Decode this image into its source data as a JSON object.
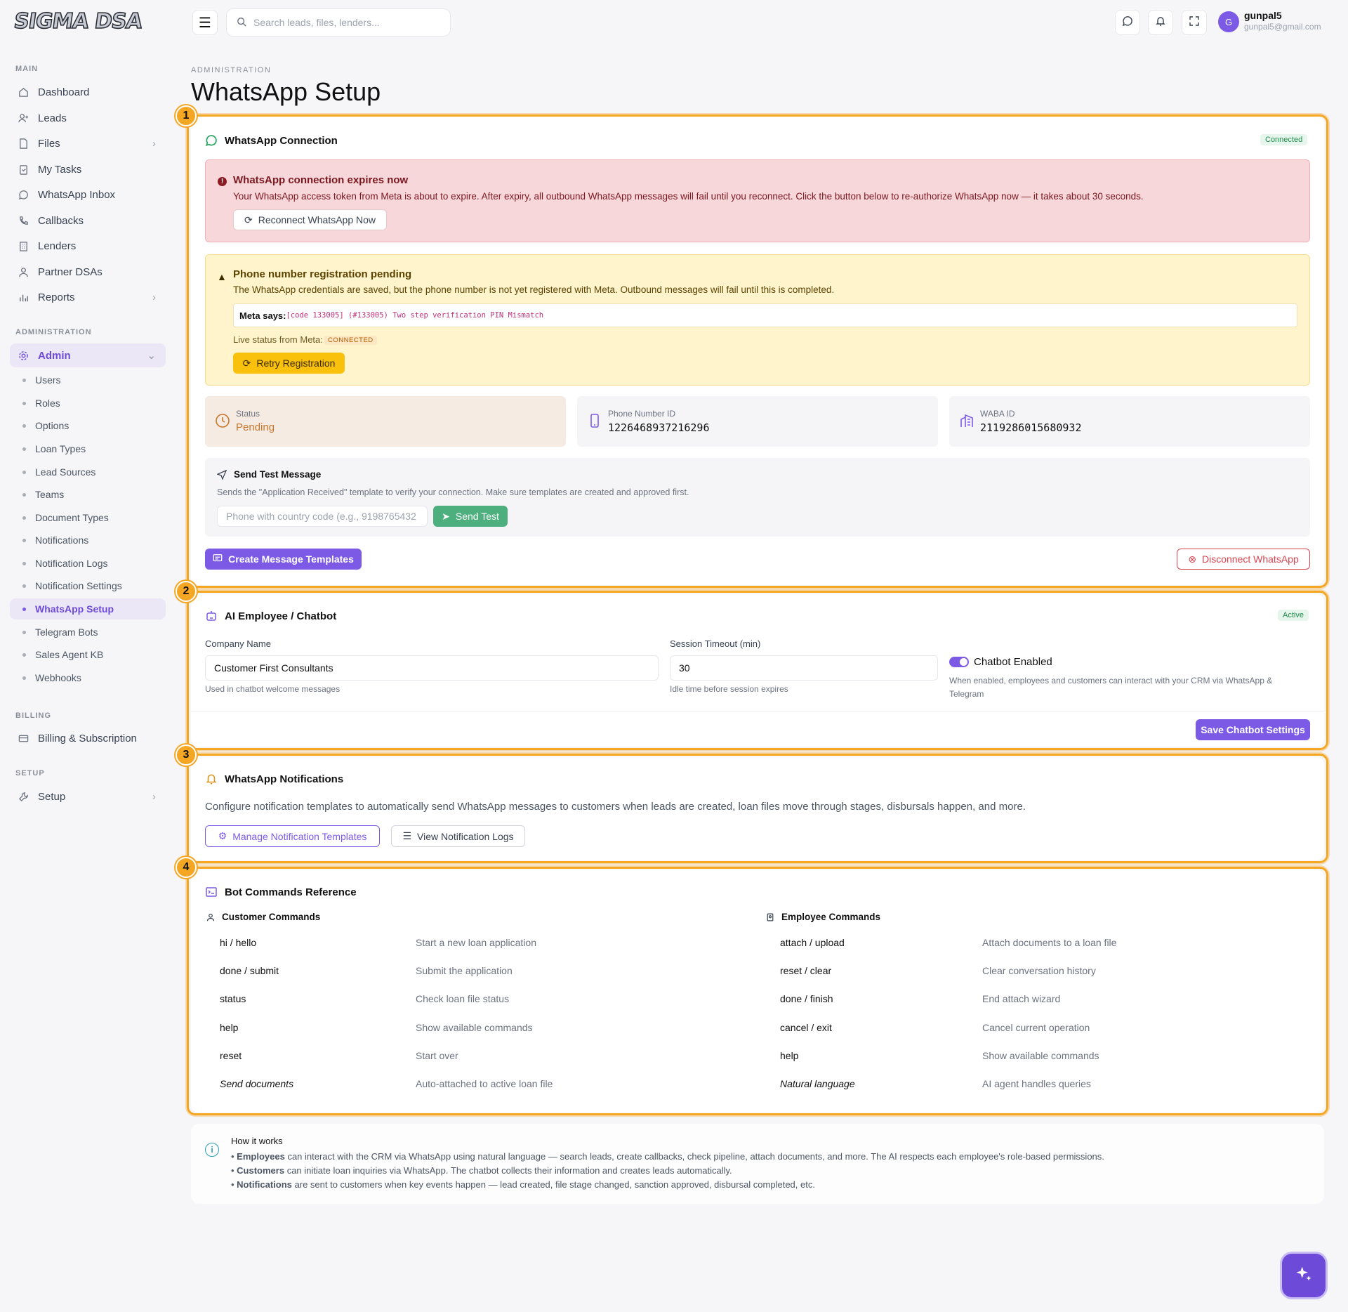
{
  "brand": {
    "logo": "SIGMA DSA"
  },
  "nav": {
    "main_label": "MAIN",
    "main_items": [
      {
        "label": "Dashboard",
        "icon": "home-icon"
      },
      {
        "label": "Leads",
        "icon": "user-plus-icon"
      },
      {
        "label": "Files",
        "icon": "file-icon"
      },
      {
        "label": "My Tasks",
        "icon": "clipboard-icon"
      },
      {
        "label": "WhatsApp Inbox",
        "icon": "whatsapp-icon"
      },
      {
        "label": "Callbacks",
        "icon": "phone-icon"
      },
      {
        "label": "Lenders",
        "icon": "building-icon"
      },
      {
        "label": "Partner DSAs",
        "icon": "users-icon"
      },
      {
        "label": "Reports",
        "icon": "bar-chart-icon"
      }
    ],
    "admin_label": "ADMINISTRATION",
    "admin_item": "Admin",
    "admin_sub": [
      "Users",
      "Roles",
      "Options",
      "Loan Types",
      "Lead Sources",
      "Teams",
      "Document Types",
      "Notifications",
      "Notification Logs",
      "Notification Settings",
      "WhatsApp Setup",
      "Telegram Bots",
      "Sales Agent KB",
      "Webhooks"
    ],
    "billing_label": "BILLING",
    "billing_item": "Billing & Subscription",
    "setup_label": "SETUP",
    "setup_item": "Setup"
  },
  "topbar": {
    "search_placeholder": "Search leads, files, lenders...",
    "user_initial": "G",
    "user_name": "gunpal5",
    "user_email": "gunpal5@gmail.com"
  },
  "page": {
    "breadcrumb": "ADMINISTRATION",
    "title": "WhatsApp Setup"
  },
  "callouts": [
    "1",
    "2",
    "3",
    "4"
  ],
  "connection": {
    "title": "WhatsApp Connection",
    "status_badge": "Connected",
    "expire_title": "WhatsApp connection expires now",
    "expire_text": "Your WhatsApp access token from Meta is about to expire. After expiry, all outbound WhatsApp messages will fail until you reconnect. Click the button below to re-authorize WhatsApp now — it takes about 30 seconds.",
    "reconnect_label": "Reconnect WhatsApp Now",
    "pending_title": "Phone number registration pending",
    "pending_text": "The WhatsApp credentials are saved, but the phone number is not yet registered with Meta. Outbound messages will fail until this is completed.",
    "meta_says_label": "Meta says:",
    "meta_says_value": "[code 133005] (#133005) Two step verification PIN Mismatch",
    "live_status_label": "Live status from Meta:",
    "live_status_value": "CONNECTED",
    "retry_label": "Retry Registration",
    "stats": [
      {
        "label": "Status",
        "value": "Pending"
      },
      {
        "label": "Phone Number ID",
        "value": "1226468937216296"
      },
      {
        "label": "WABA ID",
        "value": "2119286015680932"
      }
    ],
    "test_title": "Send Test Message",
    "test_text": "Sends the \"Application Received\" template to verify your connection. Make sure templates are created and approved first.",
    "test_placeholder": "Phone with country code (e.g., 9198765432",
    "send_label": "Send Test",
    "create_templates_label": "Create Message Templates",
    "disconnect_label": "Disconnect WhatsApp"
  },
  "chatbot": {
    "title": "AI Employee / Chatbot",
    "status_badge": "Active",
    "company_label": "Company Name",
    "company_value": "Customer First Consultants",
    "company_help": "Used in chatbot welcome messages",
    "timeout_label": "Session Timeout (min)",
    "timeout_value": "30",
    "timeout_help": "Idle time before session expires",
    "enabled_label": "Chatbot Enabled",
    "enabled_help": "When enabled, employees and customers can interact with your CRM via WhatsApp & Telegram",
    "save_label": "Save Chatbot Settings"
  },
  "notifications": {
    "title": "WhatsApp Notifications",
    "text": "Configure notification templates to automatically send WhatsApp messages to customers when leads are created, loan files move through stages, disbursals happen, and more.",
    "manage_label": "Manage Notification Templates",
    "logs_label": "View Notification Logs"
  },
  "bot": {
    "title": "Bot Commands Reference",
    "customer_title": "Customer Commands",
    "customer": [
      {
        "cmd": "hi / hello",
        "desc": "Start a new loan application"
      },
      {
        "cmd": "done / submit",
        "desc": "Submit the application"
      },
      {
        "cmd": "status",
        "desc": "Check loan file status"
      },
      {
        "cmd": "help",
        "desc": "Show available commands"
      },
      {
        "cmd": "reset",
        "desc": "Start over"
      },
      {
        "cmd": "Send documents",
        "desc": "Auto-attached to active loan file"
      }
    ],
    "employee_title": "Employee Commands",
    "employee": [
      {
        "cmd": "attach / upload",
        "desc": "Attach documents to a loan file"
      },
      {
        "cmd": "reset / clear",
        "desc": "Clear conversation history"
      },
      {
        "cmd": "done / finish",
        "desc": "End attach wizard"
      },
      {
        "cmd": "cancel / exit",
        "desc": "Cancel current operation"
      },
      {
        "cmd": "help",
        "desc": "Show available commands"
      },
      {
        "cmd": "Natural language",
        "desc": "AI agent handles queries"
      }
    ]
  },
  "howto": {
    "title": "How it works",
    "items": [
      {
        "strong": "Employees",
        "text": " can interact with the CRM via WhatsApp using natural language — search leads, create callbacks, check pipeline, attach documents, and more. The AI respects each employee's role-based permissions."
      },
      {
        "strong": "Customers",
        "text": " can initiate loan inquiries via WhatsApp. The chatbot collects their information and creates leads automatically."
      },
      {
        "strong": "Notifications",
        "text": " are sent to customers when key events happen — lead created, file stage changed, sanction approved, disbursal completed, etc."
      }
    ]
  }
}
